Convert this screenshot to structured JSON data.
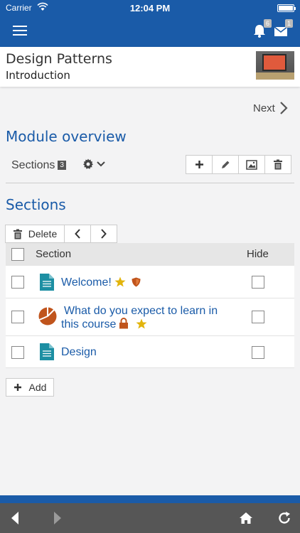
{
  "status_bar": {
    "carrier": "Carrier",
    "time": "12:04 PM"
  },
  "nav": {
    "notifications_count": "6",
    "messages_count": "1"
  },
  "course": {
    "title": "Design Patterns",
    "subtitle": "Introduction"
  },
  "next_label": "Next",
  "module_title": "Module overview",
  "tabs": {
    "sections_label": "Sections",
    "sections_count": "3"
  },
  "sections_heading": "Sections",
  "actions": {
    "delete_label": "Delete"
  },
  "table": {
    "col_section": "Section",
    "col_hide": "Hide",
    "rows": [
      {
        "title": "Welcome!",
        "icon": "document-icon",
        "markers": [
          "star-icon",
          "shield-icon"
        ]
      },
      {
        "title_line1": "What do you expect to learn in",
        "title_line2": "this course",
        "icon": "pie-chart-icon",
        "markers": [
          "lock-icon",
          "star-icon"
        ]
      },
      {
        "title": "Design",
        "icon": "document-icon",
        "markers": []
      }
    ]
  },
  "add_label": "Add",
  "colors": {
    "primary": "#1a5ba8",
    "teal": "#1d8fa3",
    "orange": "#c0541c",
    "star": "#e2b40c",
    "bottom_bar": "#565656"
  }
}
